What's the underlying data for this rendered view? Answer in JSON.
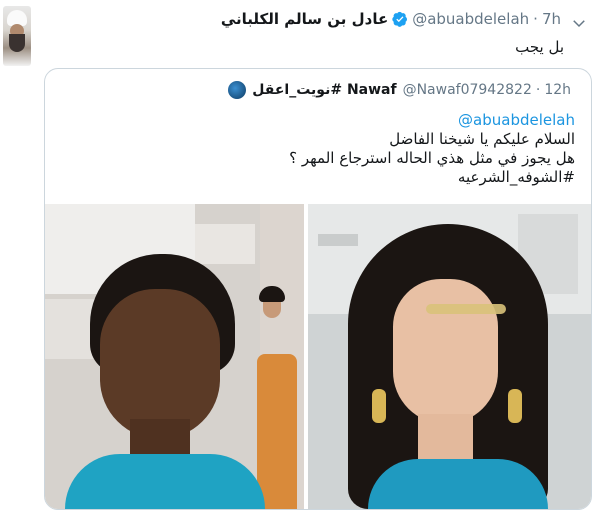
{
  "tweet": {
    "author_name": "عادل بن سالم الكلباني",
    "author_handle": "@abuabdelelah",
    "time": "7h",
    "separator": "·",
    "reply_text": "بل يجب",
    "verified": true
  },
  "quoted": {
    "author_name": "Nawaf #نويت_اعقل",
    "author_handle": "@Nawaf07942822",
    "time": "12h",
    "separator": "·",
    "lines": {
      "mention": "@abuabdelelah",
      "line1": "السلام عليكم يا شيخنا الفاضل",
      "line2": "هل يجوز في مثل هذي الحاله استرجاع المهر ؟",
      "hashtag": "#الشوفه_الشرعيه"
    }
  },
  "colors": {
    "link": "#1b95e0",
    "muted": "#657786",
    "verified_badge": "#1da1f2",
    "border": "#ccd6dd"
  },
  "icons": [
    "verified-badge-icon",
    "chevron-down-icon"
  ]
}
